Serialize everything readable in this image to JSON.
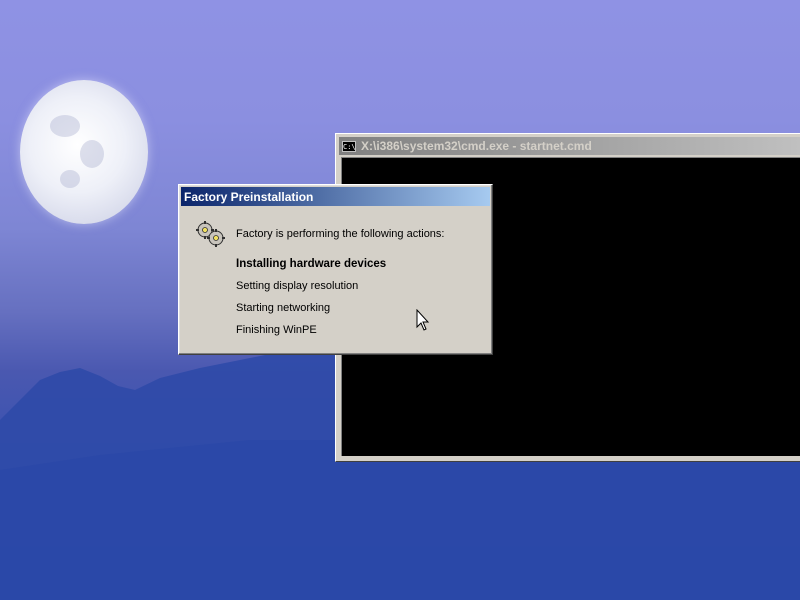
{
  "cmd_window": {
    "title": "X:\\i386\\system32\\cmd.exe - startnet.cmd",
    "icon_text": "C:\\"
  },
  "dialog": {
    "title": "Factory Preinstallation",
    "heading": "Factory is performing the following actions:",
    "steps": [
      {
        "label": "Installing hardware devices",
        "state": "active"
      },
      {
        "label": "Setting display resolution",
        "state": "pending"
      },
      {
        "label": "Starting networking",
        "state": "pending"
      },
      {
        "label": "Finishing WinPE",
        "state": "pending"
      }
    ]
  },
  "colors": {
    "titlebar_active": "#0a246a",
    "titlebar_inactive": "#808080",
    "window_face": "#d4d0c8",
    "console_bg": "#000000"
  },
  "icons": {
    "dialog": "gears-icon",
    "cmd": "console-icon",
    "pointer": "mouse-cursor"
  }
}
